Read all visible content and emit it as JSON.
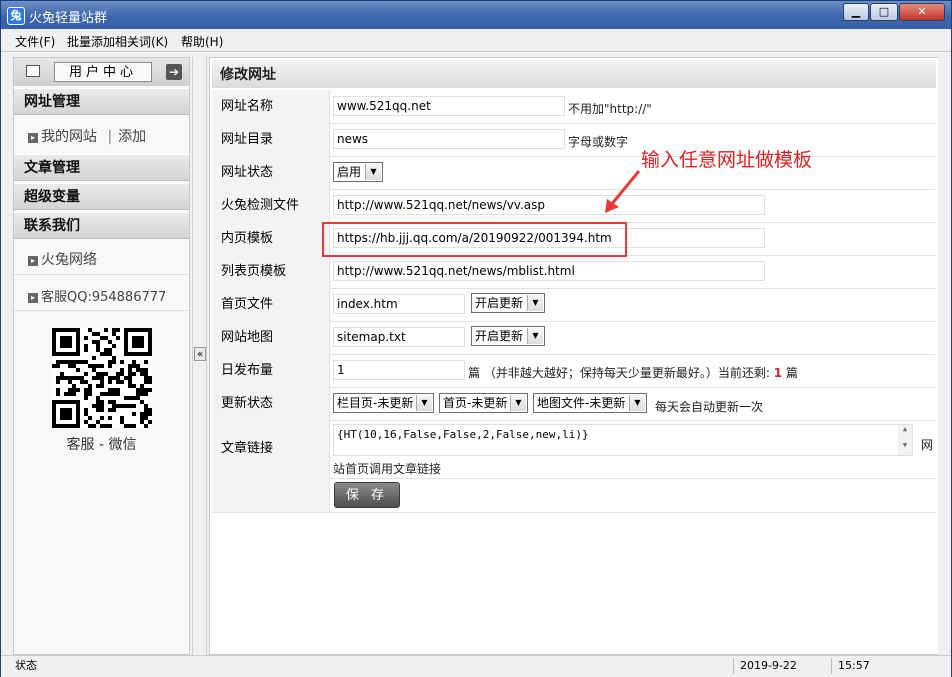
{
  "window": {
    "title": "火兔轻量站群",
    "app_icon_glyph": "兔"
  },
  "menu": [
    "文件(F)",
    "批量添加相关词(K)",
    "帮助(H)"
  ],
  "sidebar": {
    "user_center": "用户中心",
    "sections": [
      {
        "title": "网址管理",
        "items": [
          "我的网站",
          "添加"
        ]
      },
      {
        "title": "文章管理"
      },
      {
        "title": "超级变量"
      },
      {
        "title": "联系我们",
        "items": [
          "火兔网络",
          "客服QQ:954886777"
        ]
      }
    ],
    "qr_caption": "客服 - 微信"
  },
  "panel": {
    "title": "修改网址"
  },
  "form": {
    "site_name": {
      "label": "网址名称",
      "value": "www.521qq.net",
      "hint": "不用加\"http://\""
    },
    "site_dir": {
      "label": "网址目录",
      "value": "news",
      "hint": "字母或数字"
    },
    "site_status": {
      "label": "网址状态",
      "value": "启用"
    },
    "detect_file": {
      "label": "火兔检测文件",
      "value": "http://www.521qq.net/news/vv.asp"
    },
    "inner_template": {
      "label": "内页模板",
      "value": "https://hb.jjj.qq.com/a/20190922/001394.htm"
    },
    "list_template": {
      "label": "列表页模板",
      "value": "http://www.521qq.net/news/mblist.html"
    },
    "home_file": {
      "label": "首页文件",
      "value": "index.htm",
      "select": "开启更新"
    },
    "sitemap": {
      "label": "网站地图",
      "value": "sitemap.txt",
      "select": "开启更新"
    },
    "daily_count": {
      "label": "日发布量",
      "value": "1",
      "unit": "篇",
      "hint": "（并非越大越好；保持每天少量更新最好。）当前还剩:",
      "remaining": "1",
      "remaining_unit": "篇"
    },
    "update_status": {
      "label": "更新状态",
      "selects": [
        "栏目页-未更新",
        "首页-未更新",
        "地图文件-未更新"
      ],
      "hint": "每天会自动更新一次"
    },
    "article_link": {
      "label": "文章链接",
      "value": "{HT(10,16,False,False,2,False,new,li)}",
      "side_char": "网",
      "hint": "站首页调用文章链接"
    },
    "save_label": "保 存"
  },
  "annotation": {
    "text": "输入任意网址做模板",
    "color": "#e02020"
  },
  "status": {
    "label": "状态",
    "date": "2019-9-22",
    "time": "15:57"
  }
}
